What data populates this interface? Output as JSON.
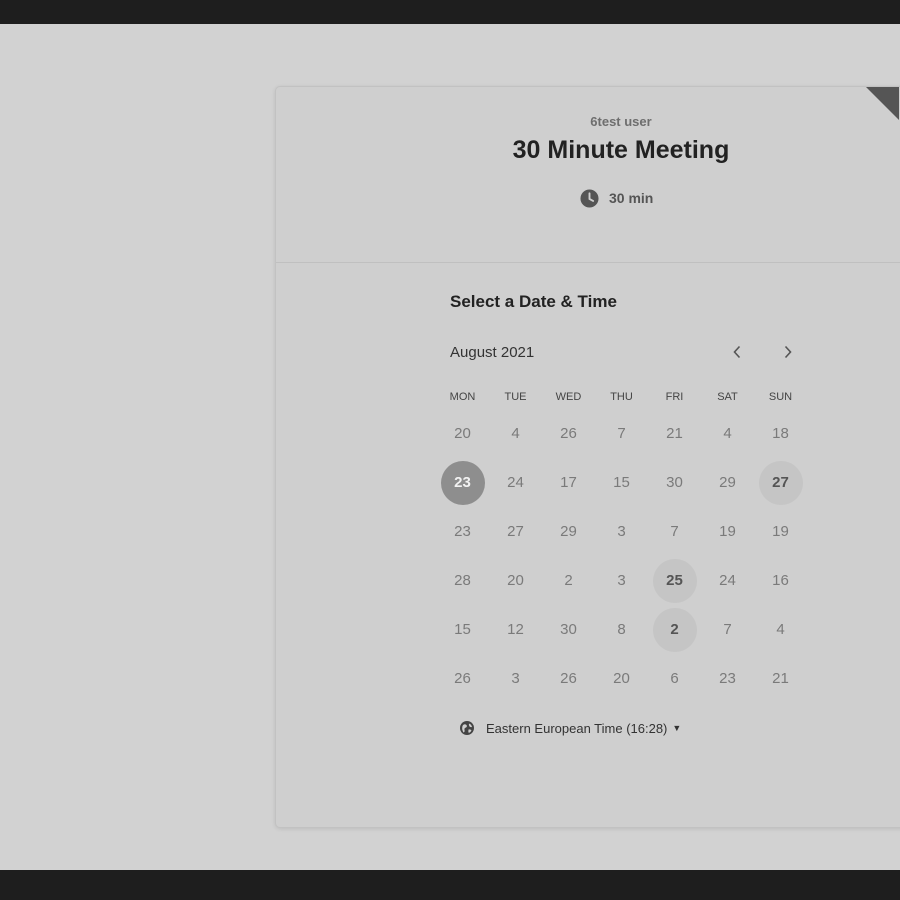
{
  "event": {
    "owner": "6test user",
    "title": "30 Minute Meeting",
    "duration": "30 min"
  },
  "calendar": {
    "heading": "Select a Date & Time",
    "month": "August 2021",
    "prev_icon": "chevron-left-icon",
    "next_icon": "chevron-right-icon",
    "weekdays": [
      "MON",
      "TUE",
      "WED",
      "THU",
      "FRI",
      "SAT",
      "SUN"
    ],
    "weeks": [
      [
        {
          "day": "20"
        },
        {
          "day": "4"
        },
        {
          "day": "26"
        },
        {
          "day": "7"
        },
        {
          "day": "21"
        },
        {
          "day": "4"
        },
        {
          "day": "18"
        }
      ],
      [
        {
          "day": "23",
          "state": "selected"
        },
        {
          "day": "24"
        },
        {
          "day": "17"
        },
        {
          "day": "15"
        },
        {
          "day": "30"
        },
        {
          "day": "29"
        },
        {
          "day": "27",
          "state": "available"
        }
      ],
      [
        {
          "day": "23"
        },
        {
          "day": "27"
        },
        {
          "day": "29"
        },
        {
          "day": "3"
        },
        {
          "day": "7"
        },
        {
          "day": "19"
        },
        {
          "day": "19"
        }
      ],
      [
        {
          "day": "28"
        },
        {
          "day": "20"
        },
        {
          "day": "2"
        },
        {
          "day": "3"
        },
        {
          "day": "25",
          "state": "available"
        },
        {
          "day": "24"
        },
        {
          "day": "16"
        }
      ],
      [
        {
          "day": "15"
        },
        {
          "day": "12"
        },
        {
          "day": "30"
        },
        {
          "day": "8"
        },
        {
          "day": "2",
          "state": "available"
        },
        {
          "day": "7"
        },
        {
          "day": "4"
        }
      ],
      [
        {
          "day": "26"
        },
        {
          "day": "3"
        },
        {
          "day": "26"
        },
        {
          "day": "20"
        },
        {
          "day": "6"
        },
        {
          "day": "23"
        },
        {
          "day": "21"
        }
      ]
    ]
  },
  "timezone": {
    "label": "Eastern European Time (16:28)",
    "icon": "globe-icon"
  },
  "colors": {
    "page_background": "#d2d2d2",
    "selected_day": "#8e8e8e",
    "available_day": "#c5c5c5",
    "corner_ribbon": "#555555"
  }
}
